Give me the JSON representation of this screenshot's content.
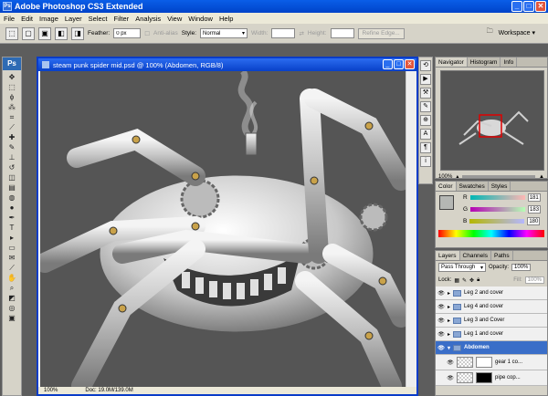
{
  "app": {
    "title": "Adobe Photoshop CS3 Extended"
  },
  "menu": [
    "File",
    "Edit",
    "Image",
    "Layer",
    "Select",
    "Filter",
    "Analysis",
    "View",
    "Window",
    "Help"
  ],
  "options": {
    "feather_label": "Feather:",
    "feather_value": "0 px",
    "antialias_label": "Anti-alias",
    "style_label": "Style:",
    "style_value": "Normal",
    "width_label": "Width:",
    "height_label": "Height:",
    "refine_label": "Refine Edge...",
    "workspace_label": "Workspace ▾"
  },
  "document": {
    "title": "steam punk spider mid.psd @ 100% (Abdomen, RGB/8)",
    "zoom": "100%",
    "doc_size": "Doc: 19.0M/139.0M"
  },
  "navigator": {
    "tabs": [
      "Navigator",
      "Histogram",
      "Info"
    ],
    "zoom": "100%"
  },
  "color": {
    "tabs": [
      "Color",
      "Swatches",
      "Styles"
    ],
    "channels": [
      {
        "label": "R",
        "value": "181"
      },
      {
        "label": "G",
        "value": "183"
      },
      {
        "label": "B",
        "value": "180"
      }
    ]
  },
  "layers": {
    "tabs": [
      "Layers",
      "Channels",
      "Paths"
    ],
    "blend_mode": "Pass Through",
    "opacity_label": "Opacity:",
    "opacity_value": "100%",
    "lock_label": "Lock:",
    "fill_label": "Fill:",
    "fill_value": "100%",
    "items": [
      {
        "name": "Leg 2 and cover"
      },
      {
        "name": "Leg 4 and cover"
      },
      {
        "name": "Leg 3 and Cover"
      },
      {
        "name": "Leg 1 and cover"
      },
      {
        "name": "Abdomen"
      },
      {
        "name": "gear 1 co..."
      },
      {
        "name": "pipe cop..."
      }
    ]
  },
  "colors": {
    "accent": "#0a5ee8",
    "selected_layer": "#3a6ec8"
  }
}
